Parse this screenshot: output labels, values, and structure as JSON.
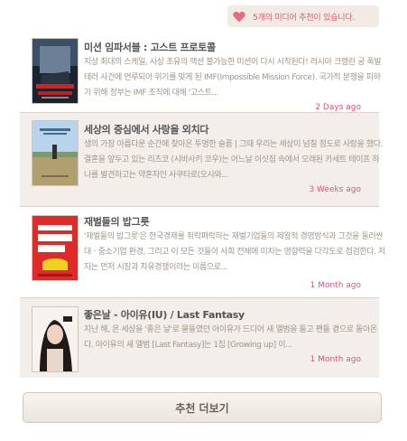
{
  "header": {
    "badge_text": "5개의 미디어 추천이 있습니다.",
    "badge_icon": "heart-icon",
    "accent_color": "#e05a70"
  },
  "items": [
    {
      "title": "미션 임파서블 : 고스트 프로토콜",
      "desc": "지상 최대의 스케일, 사상 초유의 액션   불가능한 미션이 다시 시작된다! 러시아 크렘린 궁 폭발 테러 사건에 연루되어 위기를 맞게 된 IMF(Impossible Mission Force). 국가적 분쟁을 피하기 위해 정부는 IMF 조직에 대해 '고스트...",
      "time": "2 Days ago",
      "thumb_icon": "movie-poster-icon"
    },
    {
      "title": "세상의 중심에서 사랑을 외치다",
      "desc": "생의 가장 아름다운 순간에 찾아온 투명한 슬픔 | 그때 우리는 세상이 넘칠 정도로 사랑을 했다. 결혼을 앞두고 있는 리츠코 (시바사키 코우)는 어느날 이삿짐 속에서 오래된 카세트 테이프 하나를 발견하고는 약혼자인 사쿠타로(오사와...",
      "time": "3 Weeks ago",
      "thumb_icon": "movie-poster-icon"
    },
    {
      "title": "재벌들의 밥그릇",
      "desc": "'재벌들의 밥그릇'은 한국경제를 취락펴락하는 재벌기업들의 제왕적 경영방식과 그것을 둘러싼 대ㆍ중소기업 환경, 그리고 이 모든 것들이 사회 전체에 미치는 영향력을 다각도로 점검한다. 저자는 먼저 시장과 자유경쟁이라는 이름으로...",
      "time": "1 Month ago",
      "thumb_icon": "book-cover-icon"
    },
    {
      "title": "좋은날 - 아이유(IU) / Last Fantasy",
      "desc": "지난 해, 온 세상을 '좋은 날'로 물들였던 아이유가 드디어 새 앨범을 들고 팬들 곁으로 돌아온다. 아이유의 새 앨범 [Last Fantasy]는 1집 [Growing up] 이...",
      "time": "1 Month ago",
      "thumb_icon": "album-cover-icon"
    }
  ],
  "more_button": "추천 더보기"
}
